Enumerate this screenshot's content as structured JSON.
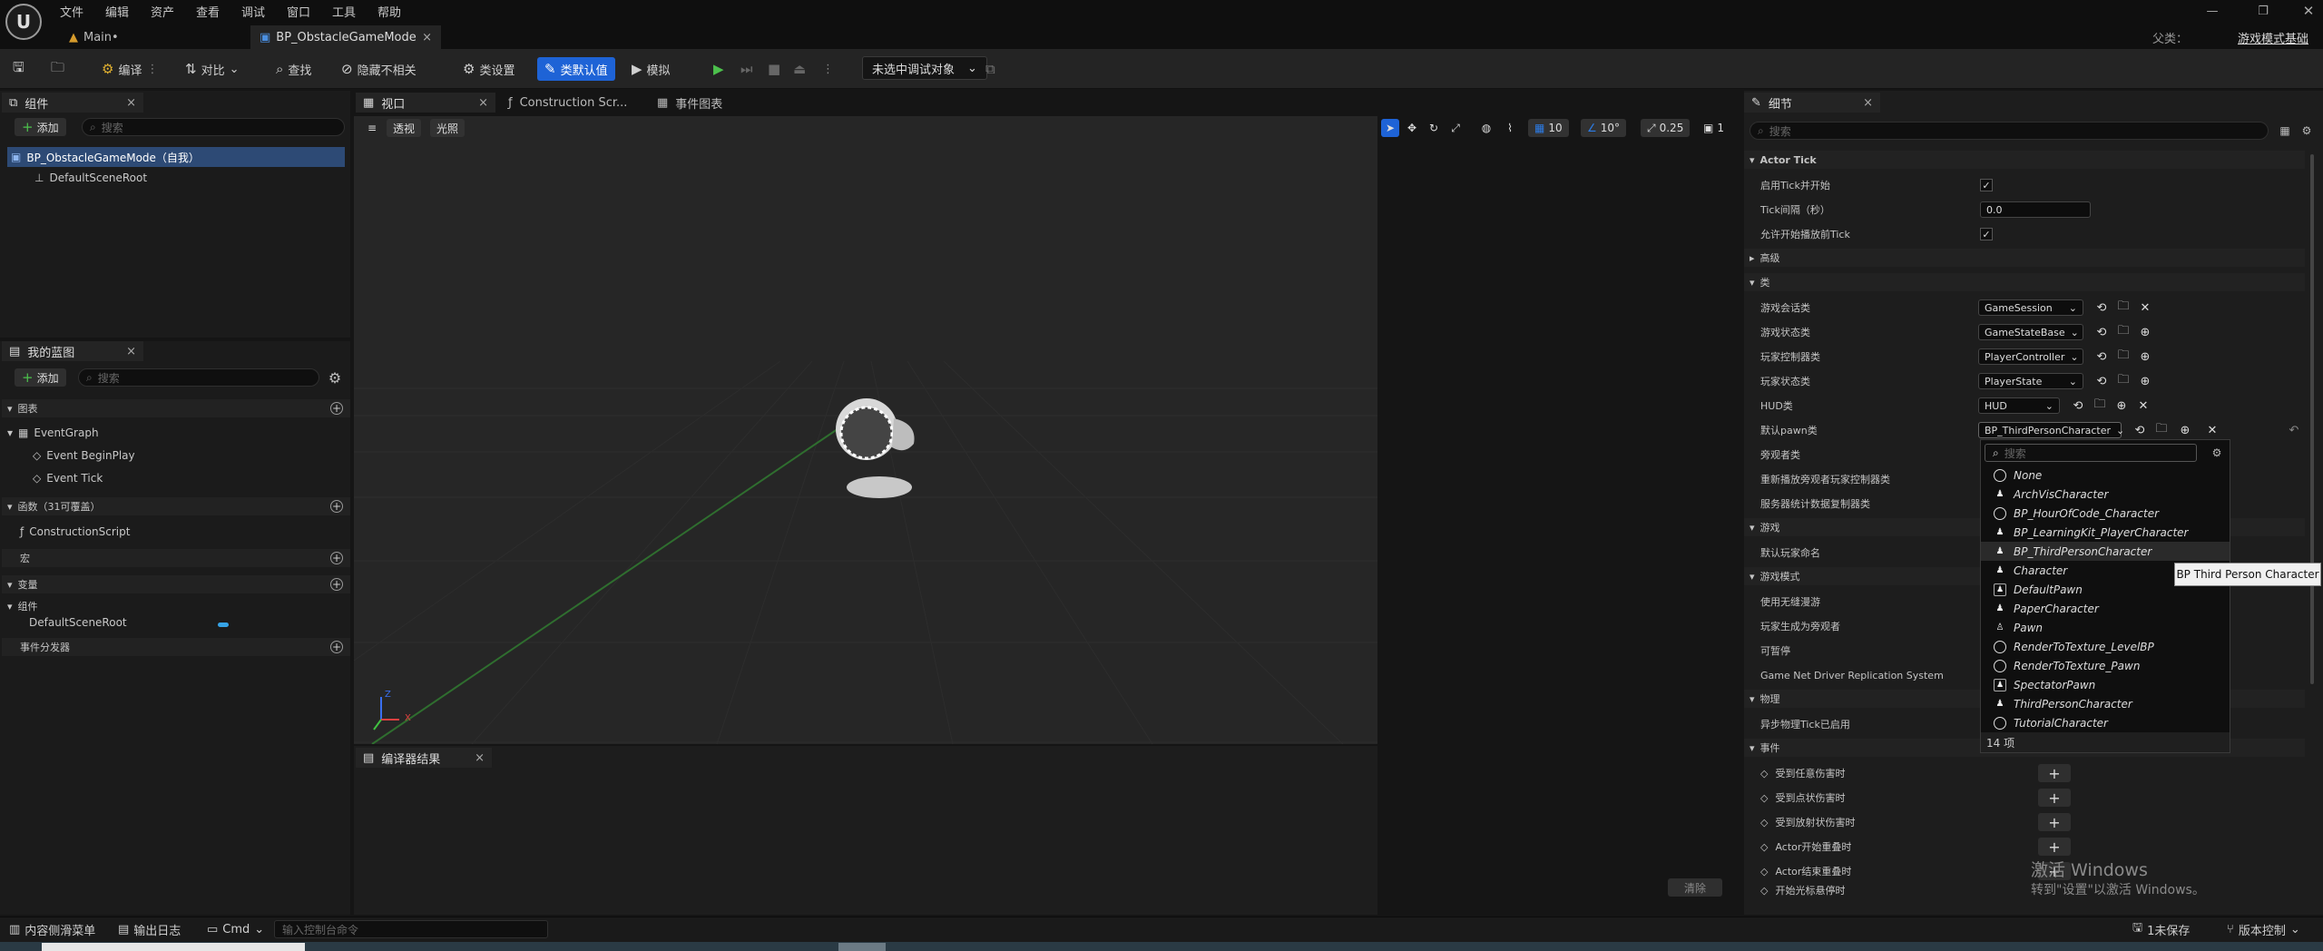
{
  "app": {
    "logo": "U",
    "parent_label": "父类：",
    "parent_value": "游戏模式基础"
  },
  "menu": [
    "文件",
    "编辑",
    "资产",
    "查看",
    "调试",
    "窗口",
    "工具",
    "帮助"
  ],
  "doc_tabs": [
    {
      "label": "Main•"
    },
    {
      "label": "BP_ObstacleGameMode",
      "close": "×"
    }
  ],
  "toolbar": {
    "compile": "编译",
    "diff": "对比",
    "find": "查找",
    "hide": "隐藏不相关",
    "class_settings": "类设置",
    "class_defaults": "类默认值",
    "simulate": "模拟",
    "debug_select": "未选中调试对象"
  },
  "components": {
    "tab": "组件",
    "add": "添加",
    "search_placeholder": "搜索",
    "items": [
      "BP_ObstacleGameMode（自我）",
      "DefaultSceneRoot"
    ]
  },
  "my_blueprint": {
    "tab": "我的蓝图",
    "add": "添加",
    "search_placeholder": "搜索",
    "graphs_header": "图表",
    "event_graph": "EventGraph",
    "events": [
      "Event BeginPlay",
      "Event Tick"
    ],
    "functions_header": "函数（31可覆盖）",
    "construction_script": "ConstructionScript",
    "macros_header": "宏",
    "variables_header": "变量",
    "components_sub": "组件",
    "default_scene_root": "DefaultSceneRoot",
    "dispatchers_header": "事件分发器"
  },
  "viewport_tabs": [
    {
      "label": "视口",
      "close": "×"
    },
    {
      "label": "Construction Scr..."
    },
    {
      "label": "事件图表"
    }
  ],
  "viewport": {
    "menu_icon": "≡",
    "perspective": "透视",
    "lit": "光照",
    "grid_snap": "10",
    "rot_snap": "10°",
    "scale_snap": "0.25",
    "cam_speed": "1",
    "axis_x": "X",
    "axis_z": "Z"
  },
  "compiler": {
    "tab": "编译器结果",
    "close": "×",
    "clear": "清除"
  },
  "details": {
    "tab": "细节",
    "close": "×",
    "search_placeholder": "搜索",
    "sections": {
      "actor_tick": "Actor Tick",
      "advanced": "高级",
      "classes": "类",
      "game": "游戏",
      "game_mode": "游戏模式",
      "physics": "物理",
      "events": "事件"
    },
    "tick_rows": [
      {
        "label": "启用Tick并开始",
        "checked": true
      },
      {
        "label": "Tick间隔（秒）",
        "value": "0.0"
      },
      {
        "label": "允许开始播放前Tick",
        "checked": true
      }
    ],
    "class_rows": [
      {
        "label": "游戏会话类",
        "value": "GameSession"
      },
      {
        "label": "游戏状态类",
        "value": "GameStateBase"
      },
      {
        "label": "玩家控制器类",
        "value": "PlayerController"
      },
      {
        "label": "玩家状态类",
        "value": "PlayerState"
      },
      {
        "label": "HUD类",
        "value": "HUD"
      },
      {
        "label": "默认pawn类",
        "value": "BP_ThirdPersonCharacter"
      },
      {
        "label": "旁观者类"
      },
      {
        "label": "重新播放旁观者玩家控制器类"
      },
      {
        "label": "服务器统计数据复制器类"
      }
    ],
    "game_rows": [
      {
        "label": "默认玩家命名"
      }
    ],
    "game_mode_rows": [
      {
        "label": "使用无缝漫游"
      },
      {
        "label": "玩家生成为旁观者"
      },
      {
        "label": "可暂停"
      },
      {
        "label": "Game Net Driver Replication System"
      }
    ],
    "physics_rows": [
      {
        "label": "异步物理Tick已启用"
      }
    ],
    "event_rows": [
      {
        "label": "受到任意伤害时"
      },
      {
        "label": "受到点状伤害时"
      },
      {
        "label": "受到放射状伤害时"
      },
      {
        "label": "Actor开始重叠时"
      },
      {
        "label": "Actor结束重叠时"
      },
      {
        "label": "开始光标悬停时"
      }
    ]
  },
  "picker": {
    "search_placeholder": "搜索",
    "items": [
      {
        "label": "None",
        "icon": "circle"
      },
      {
        "label": "ArchVisCharacter",
        "icon": "person"
      },
      {
        "label": "BP_HourOfCode_Character",
        "icon": "circle"
      },
      {
        "label": "BP_LearningKit_PlayerCharacter",
        "icon": "person"
      },
      {
        "label": "BP_ThirdPersonCharacter",
        "icon": "person"
      },
      {
        "label": "Character",
        "icon": "person"
      },
      {
        "label": "DefaultPawn",
        "icon": "box"
      },
      {
        "label": "PaperCharacter",
        "icon": "person"
      },
      {
        "label": "Pawn",
        "icon": "person"
      },
      {
        "label": "RenderToTexture_LevelBP",
        "icon": "circle"
      },
      {
        "label": "RenderToTexture_Pawn",
        "icon": "circle"
      },
      {
        "label": "SpectatorPawn",
        "icon": "box"
      },
      {
        "label": "ThirdPersonCharacter",
        "icon": "person"
      },
      {
        "label": "TutorialCharacter",
        "icon": "circle"
      }
    ],
    "count": "14 项"
  },
  "tooltip": "BP Third Person Character",
  "watermark": {
    "line1": "激活 Windows",
    "line2": "转到\"设置\"以激活 Windows。"
  },
  "statusbar": {
    "content_drawer": "内容侧滑菜单",
    "output_log": "输出日志",
    "cmd": "Cmd",
    "console_placeholder": "输入控制台命令",
    "unsaved": "1未保存",
    "source_control": "版本控制"
  }
}
